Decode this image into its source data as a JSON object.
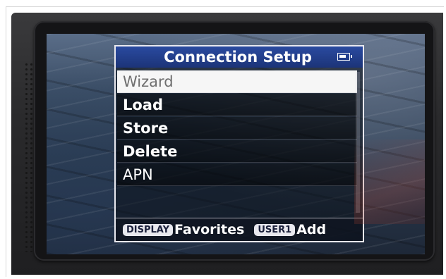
{
  "menu": {
    "title": "Connection Setup",
    "items": [
      {
        "label": "Wizard",
        "selected": true
      },
      {
        "label": "Load",
        "selected": false
      },
      {
        "label": "Store",
        "selected": false
      },
      {
        "label": "Delete",
        "selected": false
      },
      {
        "label": "APN",
        "selected": false
      }
    ],
    "status_icon": "battery-icon"
  },
  "footer": {
    "display_key": "DISPLAY",
    "display_action": "Favorites",
    "user_key": "USER1",
    "user_action": "Add"
  },
  "colors": {
    "header_bg": "#1f3b86",
    "selected_bg": "#f6f6f6",
    "selected_text": "#6e6e6e",
    "item_text": "#ffffff"
  }
}
